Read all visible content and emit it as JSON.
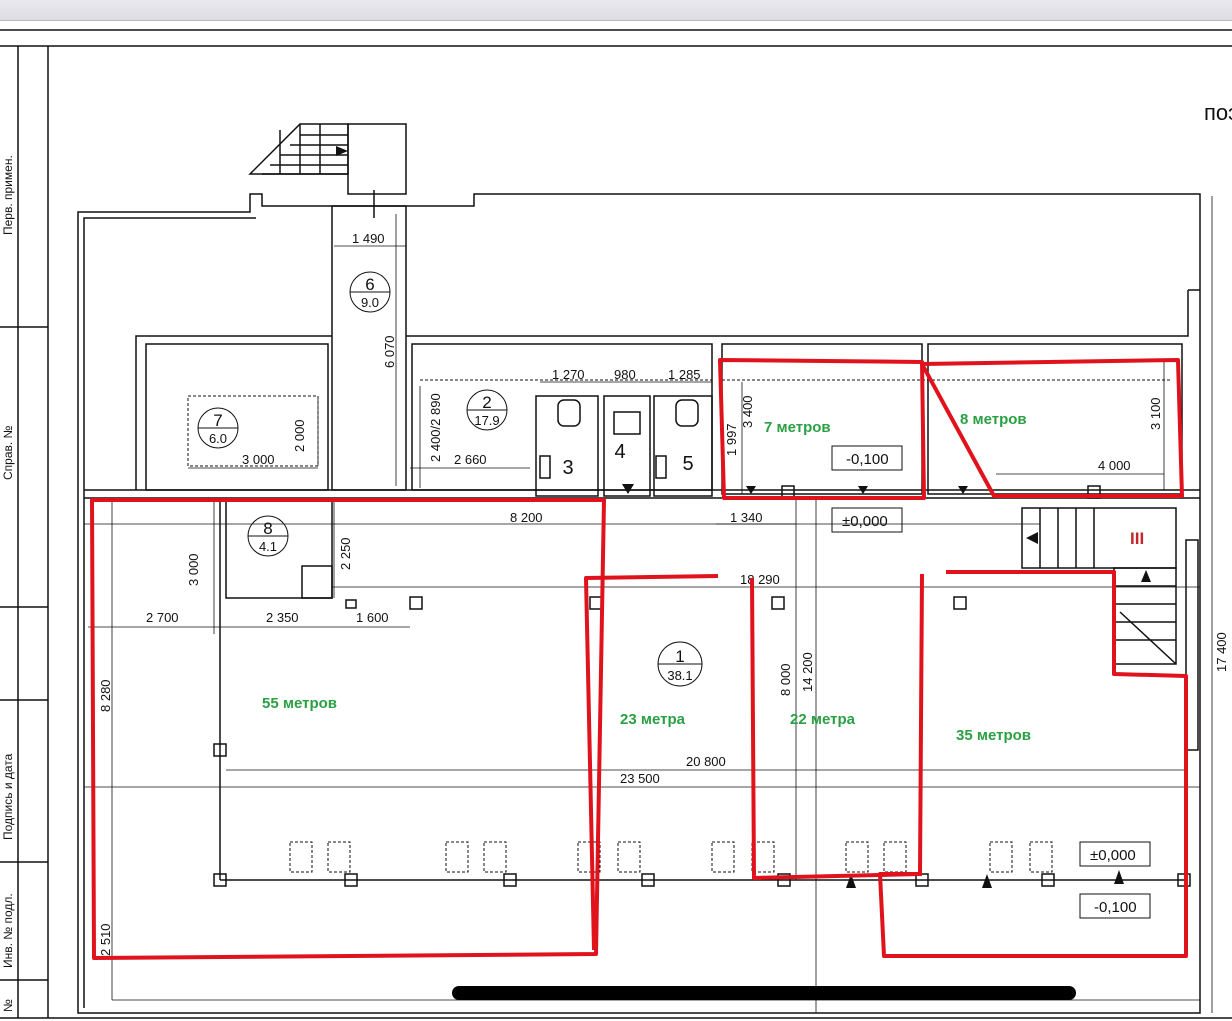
{
  "header": {
    "partial_title": "поэ"
  },
  "side_stamp": {
    "perv_primen": "Перв. примен.",
    "sprav": "Справ. №",
    "podpis_data": "Подпись и дата",
    "inv_podl": "Инв. № подл.",
    "n_mark": "№"
  },
  "rooms": {
    "r1": {
      "num": "1",
      "area": "38.1"
    },
    "r2": {
      "num": "2",
      "area": "17.9"
    },
    "r3": {
      "num": "3"
    },
    "r4": {
      "num": "4"
    },
    "r5": {
      "num": "5"
    },
    "r6": {
      "num": "6",
      "area": "9.0"
    },
    "r7": {
      "num": "7",
      "area": "6.0"
    },
    "r8": {
      "num": "8",
      "area": "4.1"
    }
  },
  "dimensions": {
    "d1490": "1 490",
    "d6070": "6 070",
    "d1270": "1 270",
    "d980": "980",
    "d1285": "1 285",
    "d1997": "1 997",
    "d3400": "3 400",
    "d3100": "3 100",
    "d4000": "4 000",
    "d2890": "2 400/2 890",
    "d2660": "2 660",
    "d3000a": "3 000",
    "d2000": "2 000",
    "d8200": "8 200",
    "d1340": "1 340",
    "d18290": "18 290",
    "d3000b": "3 000",
    "d2250": "2 250",
    "d2700": "2 700",
    "d2350": "2 350",
    "d1600": "1 600",
    "d8280": "8 280",
    "d8000": "8 000",
    "d14200": "14 200",
    "d20800": "20 800",
    "d23500": "23 500",
    "d17400": "17 400",
    "d2510": "2 510"
  },
  "levels": {
    "l1": "-0,100",
    "l2": "±0,000",
    "l3": "±0,000",
    "l4": "-0,100"
  },
  "stair_mark": "III",
  "annotations": [
    {
      "text": "7 метров"
    },
    {
      "text": "8 метров"
    },
    {
      "text": "55 метров"
    },
    {
      "text": "23 метра"
    },
    {
      "text": "22 метра"
    },
    {
      "text": "35 метров"
    }
  ],
  "colors": {
    "outline": "#e0121c",
    "label": "#2aa043",
    "lines": "#111111"
  }
}
